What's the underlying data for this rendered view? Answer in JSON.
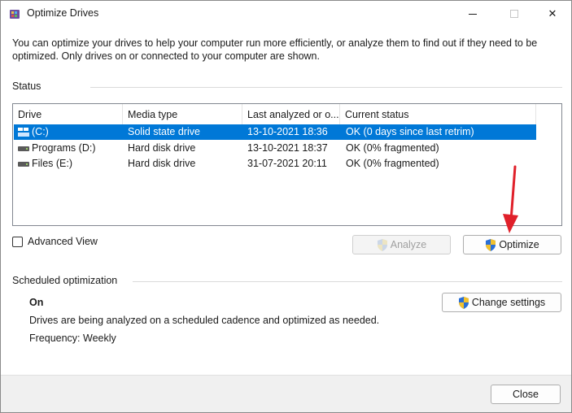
{
  "window": {
    "title": "Optimize Drives",
    "minimize_glyph": "",
    "close_glyph": "✕"
  },
  "intro": "You can optimize your drives to help your computer run more efficiently, or analyze them to find out if they need to be optimized. Only drives on or connected to your computer are shown.",
  "status": {
    "label": "Status",
    "columns": [
      "Drive",
      "Media type",
      "Last analyzed or o...",
      "Current status"
    ],
    "rows": [
      {
        "drive": "(C:)",
        "media_type": "Solid state drive",
        "last_analyzed": "13-10-2021 18:36",
        "current_status": "OK (0 days since last retrim)",
        "icon": "windows-drive-icon",
        "selected": true
      },
      {
        "drive": "Programs  (D:)",
        "media_type": "Hard disk drive",
        "last_analyzed": "13-10-2021 18:37",
        "current_status": "OK (0% fragmented)",
        "icon": "hard-drive-icon",
        "selected": false
      },
      {
        "drive": "Files (E:)",
        "media_type": "Hard disk drive",
        "last_analyzed": "31-07-2021 20:11",
        "current_status": "OK (0% fragmented)",
        "icon": "hard-drive-icon",
        "selected": false
      }
    ]
  },
  "advanced_view": {
    "label": "Advanced View",
    "checked": false
  },
  "buttons": {
    "analyze": "Analyze",
    "optimize": "Optimize",
    "change_settings": "Change settings",
    "close": "Close"
  },
  "scheduled": {
    "label": "Scheduled optimization",
    "state": "On",
    "description": "Drives are being analyzed on a scheduled cadence and optimized as needed.",
    "frequency": "Frequency: Weekly"
  },
  "colors": {
    "selection": "#0078d7",
    "annotation_arrow": "#e0202a",
    "shield_blue": "#2a6fd6",
    "shield_yellow": "#f2c12e"
  }
}
